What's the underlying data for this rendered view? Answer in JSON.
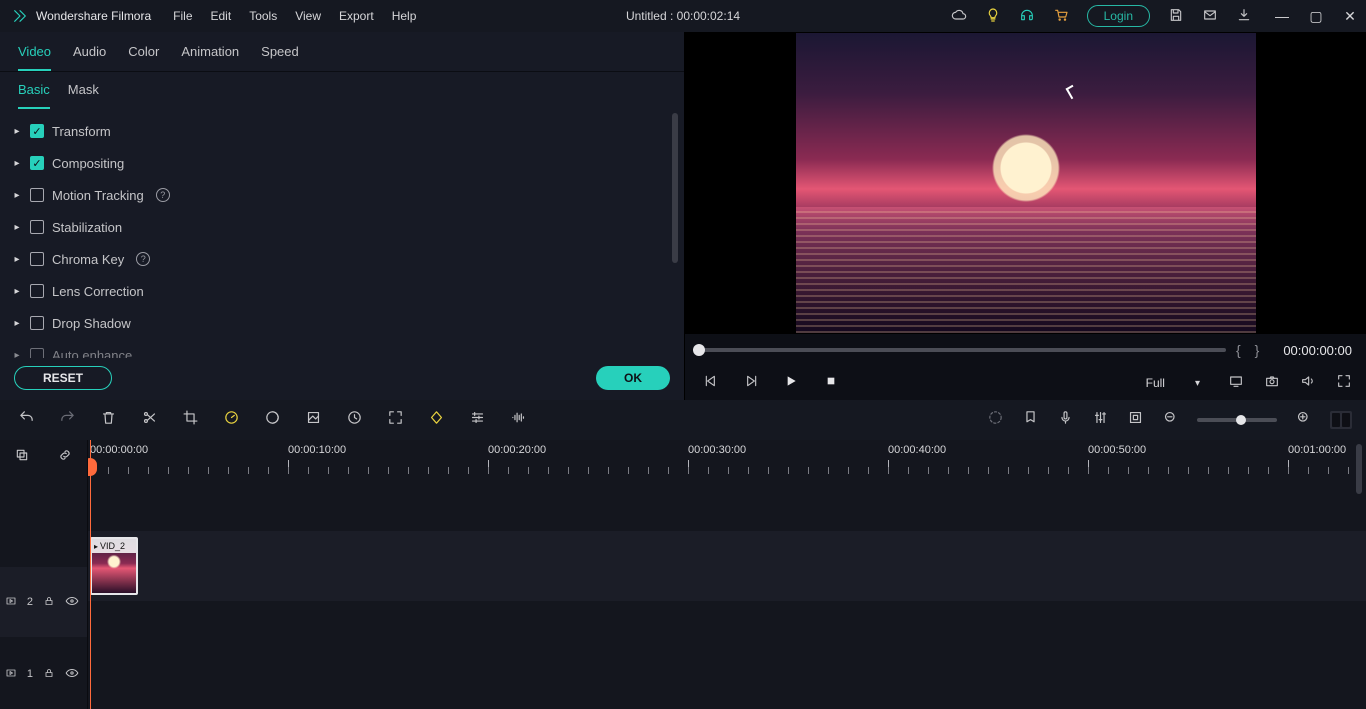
{
  "app": {
    "name": "Wondershare Filmora"
  },
  "menu": [
    "File",
    "Edit",
    "Tools",
    "View",
    "Export",
    "Help"
  ],
  "project": {
    "title": "Untitled : 00:00:02:14"
  },
  "title_right": {
    "login_label": "Login",
    "cloud_icon": "cloud-icon",
    "bulb_icon": "bulb-icon",
    "headset_icon": "headset-icon",
    "cart_icon": "cart-icon",
    "save_icon": "save-icon",
    "mail_icon": "mail-icon",
    "download_icon": "download-arrow-icon"
  },
  "panel": {
    "tabs_primary": [
      "Video",
      "Audio",
      "Color",
      "Animation",
      "Speed"
    ],
    "tabs_primary_active": 0,
    "tabs_secondary": [
      "Basic",
      "Mask"
    ],
    "tabs_secondary_active": 0,
    "properties": [
      {
        "label": "Transform",
        "checked": true,
        "help": false
      },
      {
        "label": "Compositing",
        "checked": true,
        "help": false
      },
      {
        "label": "Motion Tracking",
        "checked": false,
        "help": true
      },
      {
        "label": "Stabilization",
        "checked": false,
        "help": false
      },
      {
        "label": "Chroma Key",
        "checked": false,
        "help": true
      },
      {
        "label": "Lens Correction",
        "checked": false,
        "help": false
      },
      {
        "label": "Drop Shadow",
        "checked": false,
        "help": false
      },
      {
        "label": "Auto enhance",
        "checked": false,
        "help": false
      }
    ],
    "reset_label": "RESET",
    "ok_label": "OK"
  },
  "preview": {
    "brace_open": "{",
    "brace_close": "}",
    "timecode": "00:00:00:00",
    "quality_label": "Full"
  },
  "timeline": {
    "ruler": [
      "00:00:00:00",
      "00:00:10:00",
      "00:00:20:00",
      "00:00:30:00",
      "00:00:40:00",
      "00:00:50:00",
      "00:01:00:00"
    ],
    "tracks": [
      {
        "id": "2",
        "clip_label": "VID_2"
      },
      {
        "id": "1"
      }
    ]
  }
}
